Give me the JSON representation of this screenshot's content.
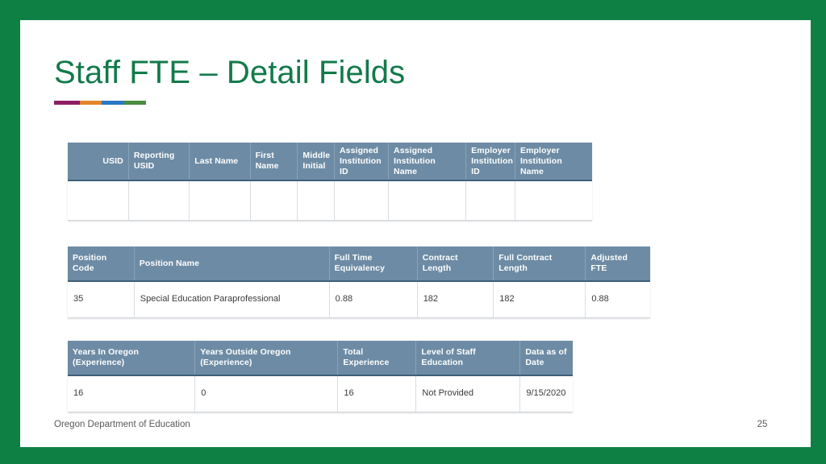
{
  "slide": {
    "title": "Staff FTE – Detail Fields",
    "frame_color": "#0f8043",
    "title_color": "#127a4a",
    "header_fill": "#6d8ba4"
  },
  "accent_bar": {
    "segments": [
      "#8e1f64",
      "#e3852a",
      "#2a79c4",
      "#4a8c3f"
    ]
  },
  "tables": {
    "staff_identity": {
      "columns": [
        "USID",
        "Reporting USID",
        "Last Name",
        "First Name",
        "Middle Initial",
        "Assigned Institution ID",
        "Assigned Institution Name",
        "Employer Institution ID",
        "Employer Institution Name"
      ],
      "rows": [
        [
          "",
          "",
          "",
          "",
          "",
          "",
          "",
          "",
          ""
        ]
      ]
    },
    "position_detail": {
      "columns": [
        "Position Code",
        "Position Name",
        "Full Time Equivalency",
        "Contract Length",
        "Full Contract Length",
        "Adjusted FTE"
      ],
      "rows": [
        [
          "35",
          "Special Education Paraprofessional",
          "0.88",
          "182",
          "182",
          "0.88"
        ]
      ]
    },
    "experience_detail": {
      "columns": [
        "Years In Oregon (Experience)",
        "Years Outside Oregon (Experience)",
        "Total Experience",
        "Level of Staff Education",
        "Data as of Date"
      ],
      "rows": [
        [
          "16",
          "0",
          "16",
          "Not Provided",
          "9/15/2020"
        ]
      ]
    }
  },
  "footer": {
    "organization": "Oregon Department of Education",
    "page_number": "25"
  }
}
